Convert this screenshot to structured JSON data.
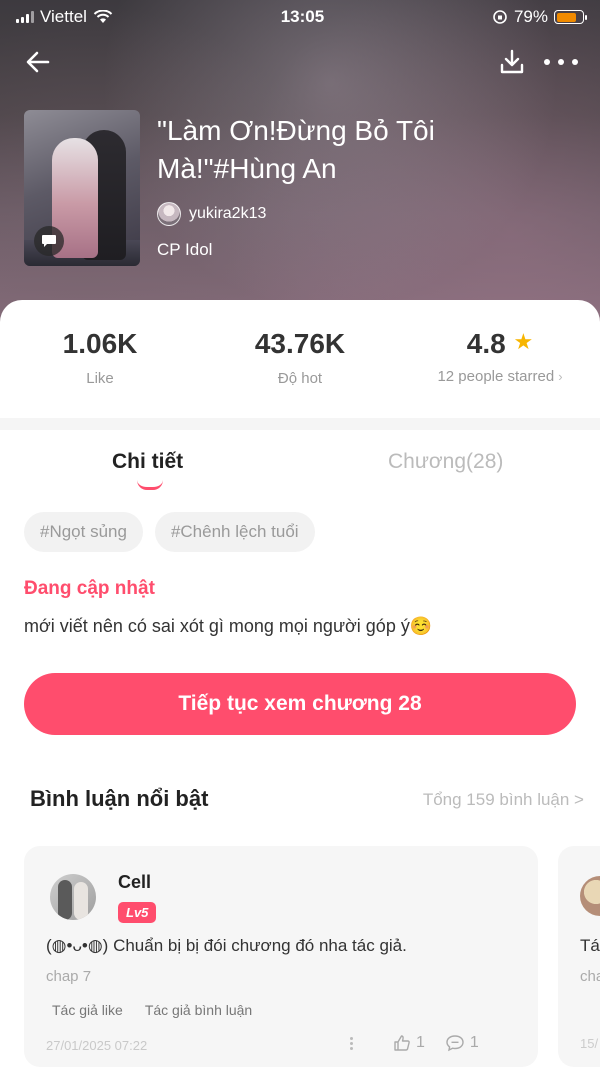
{
  "status_bar": {
    "carrier": "Viettel",
    "time": "13:05",
    "battery": "79%",
    "battery_level": 0.79
  },
  "story": {
    "title": "\"Làm Ơn!Đừng Bỏ Tôi Mà!\"#Hùng An",
    "author": "yukira2k13",
    "category": "CP Idol"
  },
  "stats": {
    "likes": "1.06K",
    "likes_label": "Like",
    "hot": "43.76K",
    "hot_label": "Độ hot",
    "rating": "4.8",
    "rating_label": "12 people starred"
  },
  "tabs": {
    "detail": "Chi tiết",
    "chapters": "Chương(28)"
  },
  "tags": [
    "#Ngọt sủng",
    "#Chênh lệch tuổi"
  ],
  "update_status": "Đang cập nhật",
  "description": "mới viết nên có sai xót gì mong mọi người góp ý☺️",
  "continue_button": "Tiếp tục xem chương 28",
  "comments": {
    "title": "Bình luận nổi bật",
    "total": "Tổng 159 bình luận >",
    "items": [
      {
        "name": "Cell",
        "level": "Lv5",
        "text": "(◍•ᴗ•◍) Chuẩn bị bị đói chương đó nha tác giả.",
        "chapter": "chap 7",
        "badges": [
          "Tác giả like",
          "Tác giả bình luận"
        ],
        "date": "27/01/2025 07:22",
        "likes": "1",
        "replies": "1"
      },
      {
        "text": "Tá",
        "chapter": "cha",
        "date": "15/"
      }
    ]
  },
  "colors": {
    "accent": "#ff4d6d",
    "star": "#f7b500",
    "battery": "#f08a00"
  }
}
